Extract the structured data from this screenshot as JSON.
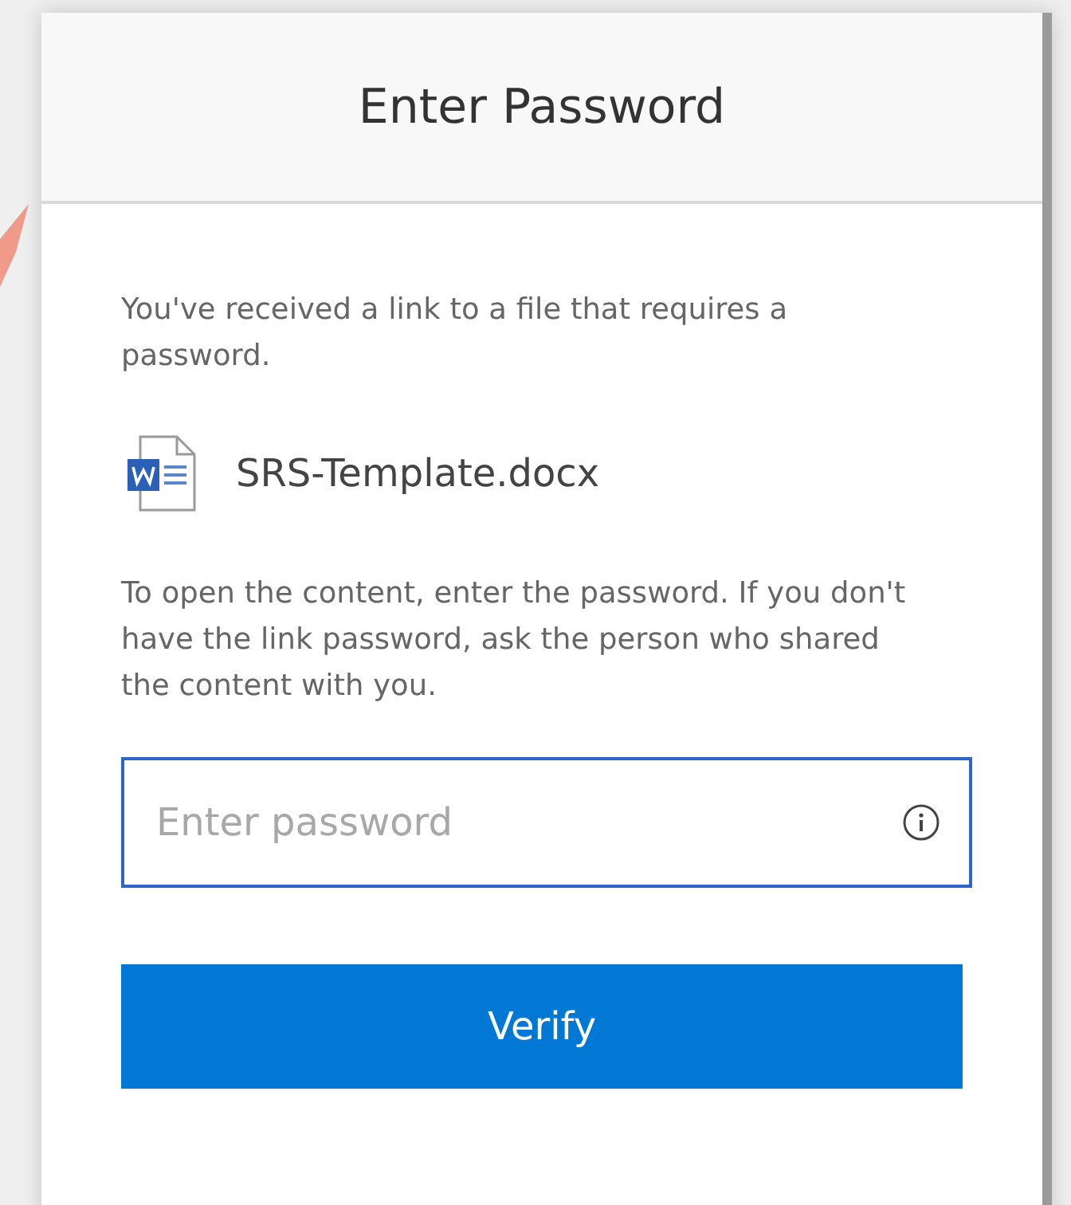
{
  "dialog": {
    "title": "Enter Password",
    "intro": "You've received a link to a file that requires a password.",
    "file": {
      "name": "SRS-Template.docx"
    },
    "instructions": "To open the content, enter the password. If you don't have the link password, ask the person who shared the content with you.",
    "password_field": {
      "placeholder": "Enter password",
      "focused": true
    },
    "button": "Verify"
  }
}
